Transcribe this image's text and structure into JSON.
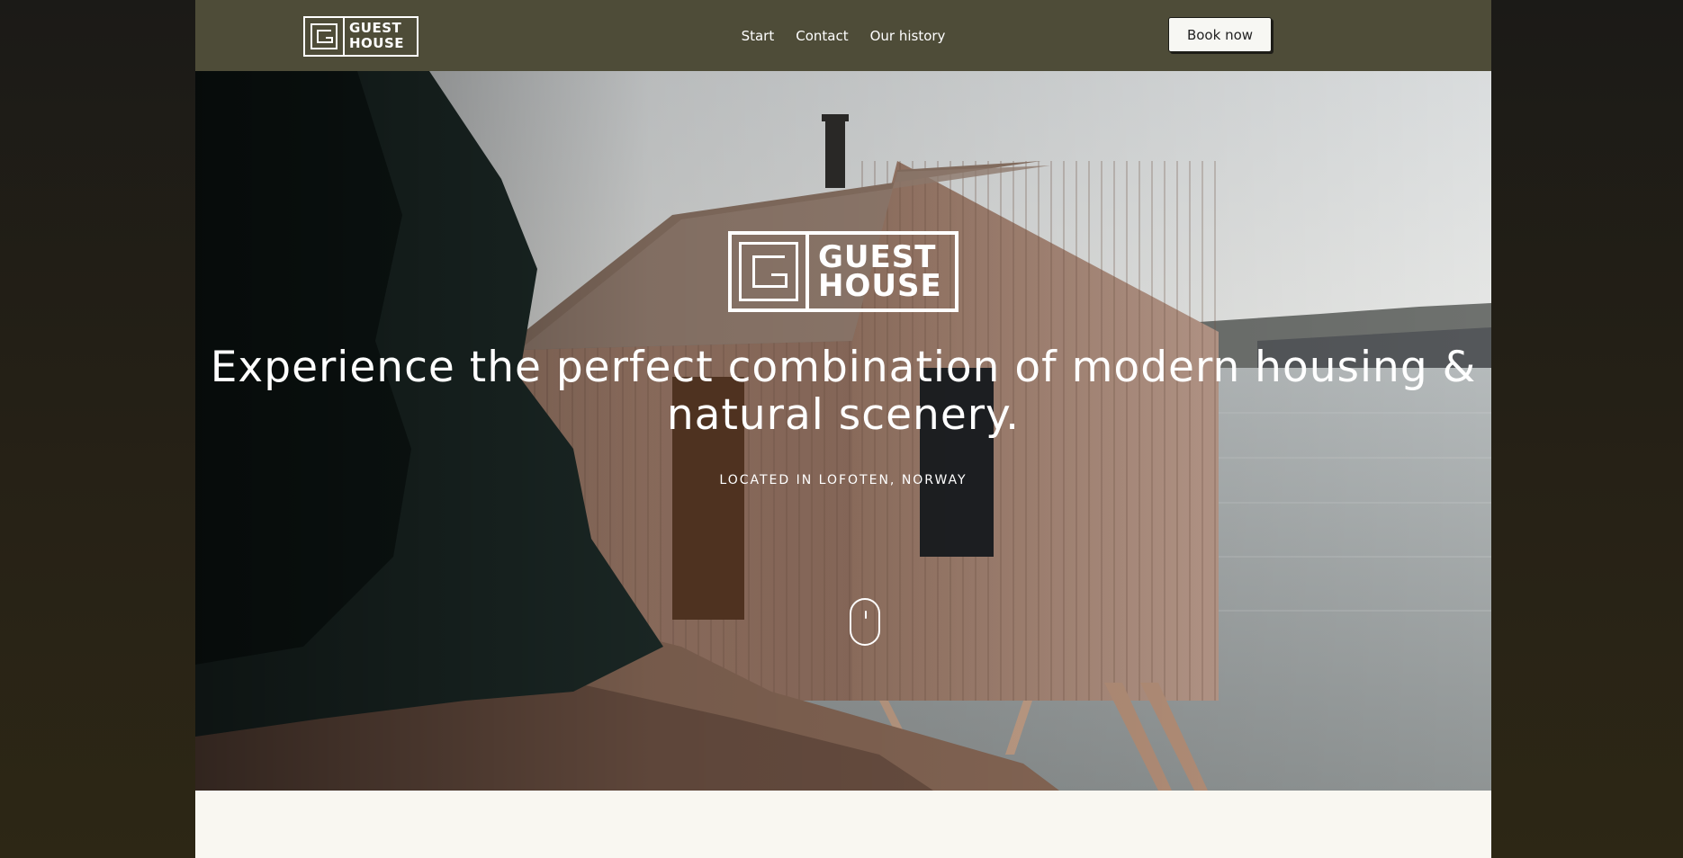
{
  "brand": {
    "logo_line1": "GUEST",
    "logo_line2": "HOUSE"
  },
  "nav": {
    "links": [
      "Start",
      "Contact",
      "Our history"
    ],
    "cta": "Book now"
  },
  "hero": {
    "headline": "Experience the perfect combination of modern housing & natural scenery.",
    "subline": "LOCATED IN LOFOTEN, NORWAY",
    "scroll_icon": "mouse-scroll-icon"
  },
  "colors": {
    "nav_bg": "#4e4c38",
    "page_bg": "#f9f7f1",
    "outer_bg": "#262116"
  }
}
